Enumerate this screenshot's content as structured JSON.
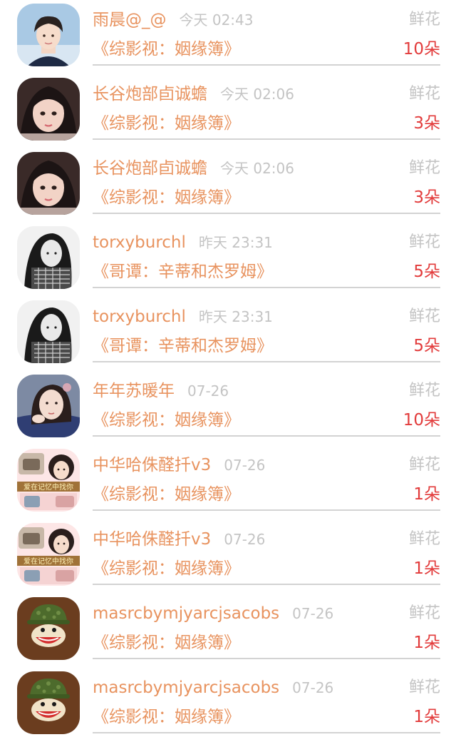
{
  "rows": [
    {
      "user": "雨晨@_@",
      "time": "今天 02:43",
      "gift": "鲜花",
      "book": "《综影视：姻缘簿》",
      "count": "10朵",
      "avatar_icon": "avatar-young-man"
    },
    {
      "user": "长谷炮部卣诚蟾",
      "time": "今天 02:06",
      "gift": "鲜花",
      "book": "《综影视：姻缘簿》",
      "count": "3朵",
      "avatar_icon": "avatar-girl-selfie"
    },
    {
      "user": "长谷炮部卣诚蟾",
      "time": "今天 02:06",
      "gift": "鲜花",
      "book": "《综影视：姻缘簿》",
      "count": "3朵",
      "avatar_icon": "avatar-girl-selfie"
    },
    {
      "user": "torxyburchl",
      "time": "昨天 23:31",
      "gift": "鲜花",
      "book": "《哥谭：辛蒂和杰罗姆》",
      "count": "5朵",
      "avatar_icon": "avatar-bw-portrait"
    },
    {
      "user": "torxyburchl",
      "time": "昨天 23:31",
      "gift": "鲜花",
      "book": "《哥谭：辛蒂和杰罗姆》",
      "count": "5朵",
      "avatar_icon": "avatar-bw-portrait"
    },
    {
      "user": "年年苏暖年",
      "time": "07-26",
      "gift": "鲜花",
      "book": "《综影视：姻缘簿》",
      "count": "10朵",
      "avatar_icon": "avatar-woman-portrait"
    },
    {
      "user": "中华哈侏醛扦v3",
      "time": "07-26",
      "gift": "鲜花",
      "book": "《综影视：姻缘簿》",
      "count": "1朵",
      "avatar_icon": "avatar-collage",
      "avatar_text": "爱在记忆中找你"
    },
    {
      "user": "中华哈侏醛扦v3",
      "time": "07-26",
      "gift": "鲜花",
      "book": "《综影视：姻缘簿》",
      "count": "1朵",
      "avatar_icon": "avatar-collage",
      "avatar_text": "爱在记忆中找你"
    },
    {
      "user": "masrcbymjyarcjsacobs",
      "time": "07-26",
      "gift": "鲜花",
      "book": "《综影视：姻缘簿》",
      "count": "1朵",
      "avatar_icon": "avatar-monkey-helmet"
    },
    {
      "user": "masrcbymjyarcjsacobs",
      "time": "07-26",
      "gift": "鲜花",
      "book": "《综影视：姻缘簿》",
      "count": "1朵",
      "avatar_icon": "avatar-monkey-helmet"
    }
  ],
  "colors": {
    "name": "#e8935f",
    "meta": "#c4c4c4",
    "count": "#e23b3b",
    "divider": "#d3d3d3"
  }
}
